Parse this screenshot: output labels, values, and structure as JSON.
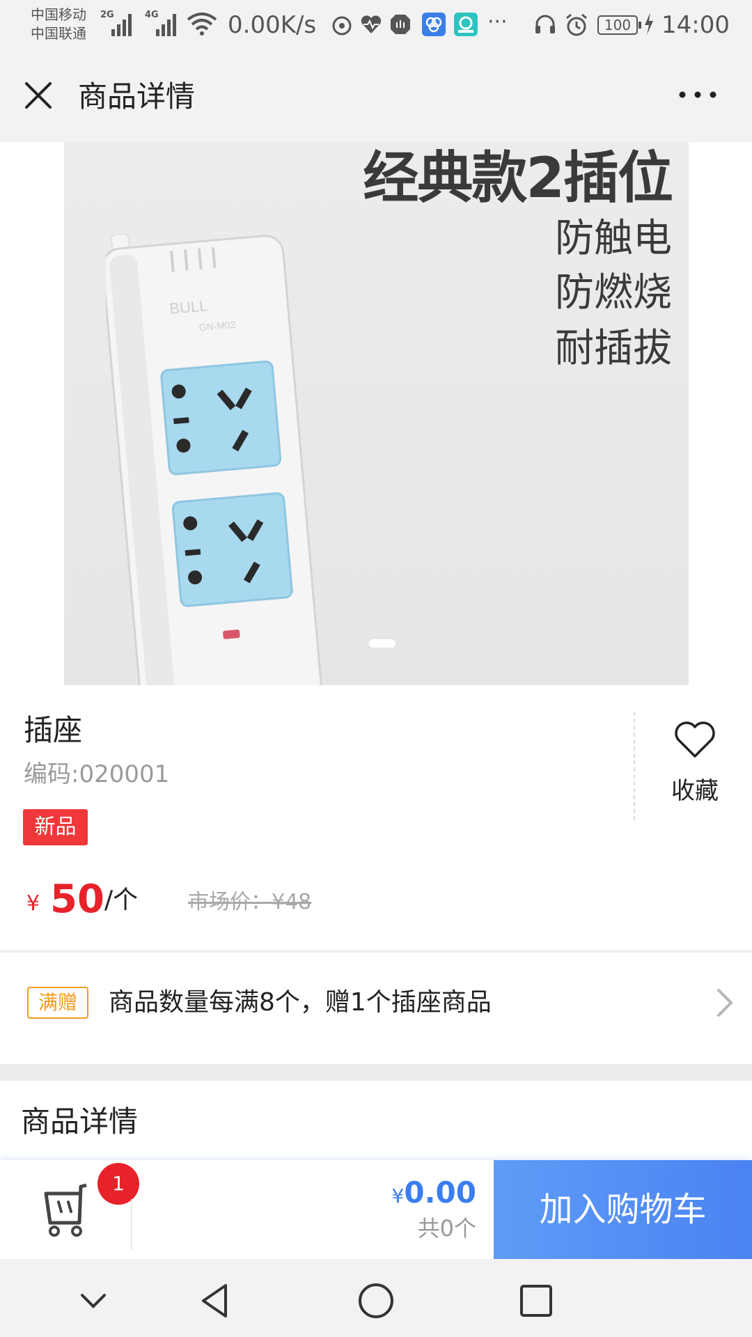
{
  "status_bar": {
    "carriers": [
      "中国移动",
      "中国联通"
    ],
    "network_2g": "2G",
    "network_4g": "4G",
    "net_speed": "0.00K/s",
    "overflow": "···",
    "battery": "100",
    "time": "14:00"
  },
  "header": {
    "title": "商品详情"
  },
  "hero": {
    "headline": "经典款2插位",
    "features": [
      "防触电",
      "防燃烧",
      "耐插拔"
    ]
  },
  "product": {
    "name": "插座",
    "code": "编码:020001",
    "badge": "新品",
    "favorite_label": "收藏",
    "price_currency": "¥",
    "price": "50",
    "unit": "/个",
    "market_price": "市场价：¥48"
  },
  "promo": {
    "tag": "满赠",
    "text": "商品数量每满8个，赠1个插座商品"
  },
  "details": {
    "heading": "商品详情"
  },
  "cart": {
    "badge_count": "1",
    "total_currency": "¥",
    "total": "0.00",
    "total_count": "共0个",
    "add_button": "加入购物车"
  },
  "colors": {
    "accent_blue": "#4a83f2",
    "price_red": "#e8222a",
    "promo_orange": "#f09a1e"
  }
}
